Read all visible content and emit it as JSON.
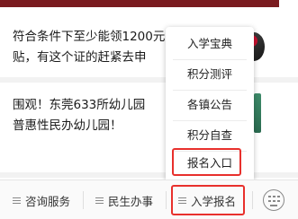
{
  "feed": {
    "article1": {
      "line1": "符合条件下至少能领1200元",
      "line2": "贴，有这个证的赶紧去申"
    },
    "article2": {
      "line1": "围观！东莞633所幼儿园",
      "line2": "普惠性民办幼儿园！"
    }
  },
  "popup_menu": {
    "items": [
      "入学宝典",
      "积分测评",
      "各镇公告",
      "积分自查",
      "报名入口"
    ],
    "highlighted_index": 4,
    "highlight_color": "#e8302c"
  },
  "tabbar": {
    "tabs": [
      {
        "label": "咨询服务"
      },
      {
        "label": "民生办事"
      },
      {
        "label": "入学报名"
      }
    ],
    "active_index": 2,
    "keyboard_icon": "keyboard-icon"
  },
  "colors": {
    "header_strip": "#7a1b1f",
    "highlight": "#e8302c"
  }
}
